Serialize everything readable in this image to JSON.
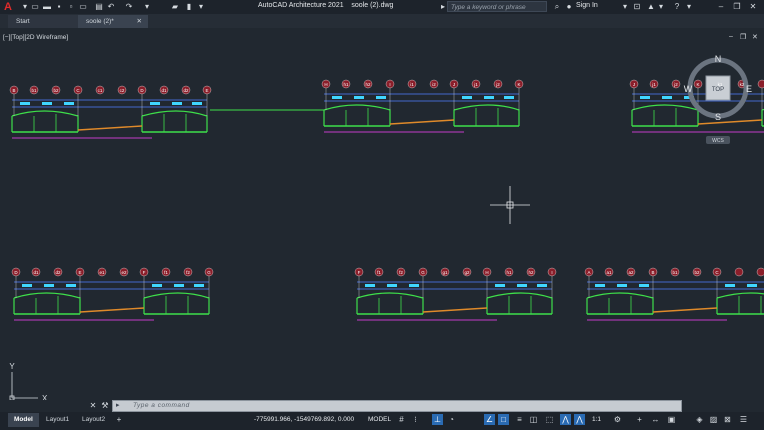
{
  "app": {
    "logo_letter": "A",
    "title": "AutoCAD Architecture 2021",
    "filename": "soole (2).dwg",
    "search_placeholder": "Type a keyword or phrase",
    "signin_label": "Sign In"
  },
  "tabs": [
    {
      "label": "Start"
    },
    {
      "label": "soole (2)*"
    }
  ],
  "viewport": {
    "label": "[−][Top][2D Wireframe]",
    "viewcube": {
      "top": "TOP",
      "n": "N",
      "s": "S",
      "e": "E",
      "w": "W",
      "wcs": "WCS"
    },
    "ucs": {
      "x": "X",
      "y": "Y"
    }
  },
  "drawings": {
    "row1_group1": [
      "B",
      "b1",
      "b2",
      "C",
      "c1",
      "c2",
      "D",
      "d1",
      "d2",
      "E"
    ],
    "row1_group2": [
      "H",
      "h1",
      "h2",
      "I",
      "i1",
      "i2",
      "J",
      "j1",
      "j2",
      "K"
    ],
    "row1_group3": [
      "J",
      "j1",
      "j2",
      "K",
      "k1",
      "k2"
    ],
    "row2_group1": [
      "D",
      "d1",
      "d2",
      "E",
      "e1",
      "e2",
      "F",
      "f1",
      "f2",
      "G"
    ],
    "row2_group2": [
      "F",
      "f1",
      "f2",
      "G",
      "g1",
      "g2",
      "H",
      "h1",
      "h2",
      "I"
    ],
    "row2_group3": [
      "A",
      "a1",
      "a2",
      "B",
      "b1",
      "b2",
      "C"
    ]
  },
  "command": {
    "placeholder": "Type a command"
  },
  "status": {
    "layouts": [
      "Model",
      "Layout1",
      "Layout2"
    ],
    "coords": "-775991.966, -1549769.892, 0.000",
    "mode": "MODEL",
    "scale": "1:1"
  },
  "colors": {
    "background": "#212830",
    "profile": "#3ee04a",
    "grid_bubble": "#8b1e2a",
    "dimension": "#4f7dff",
    "label": "#40d6ff",
    "ground": "#c23cc9",
    "centerline": "#e08a2a"
  }
}
